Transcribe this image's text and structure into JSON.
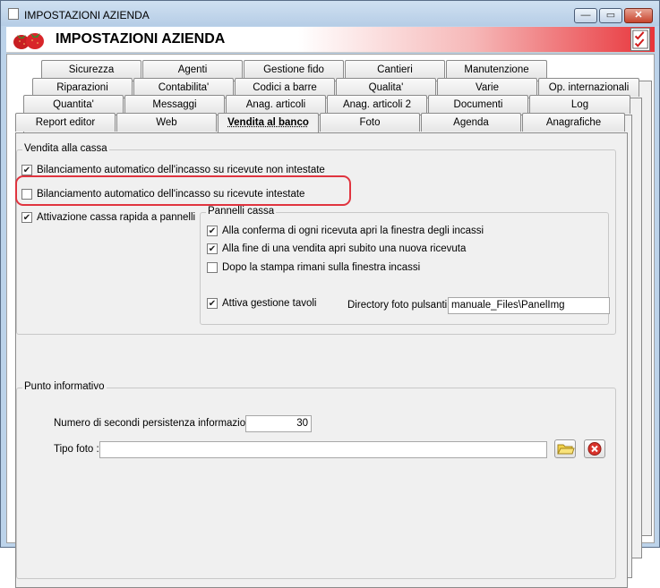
{
  "window": {
    "title": "IMPOSTAZIONI AZIENDA",
    "header_title": "IMPOSTAZIONI AZIENDA",
    "buttons": {
      "minimize": "—",
      "maximize": "▭",
      "close": "✕"
    }
  },
  "tabs": {
    "row1": [
      "Sicurezza",
      "Agenti",
      "Gestione fido",
      "Cantieri",
      "Manutenzione"
    ],
    "row2": [
      "Riparazioni",
      "Contabilita'",
      "Codici a barre",
      "Qualita'",
      "Varie",
      "Op. internazionali"
    ],
    "row3": [
      "Quantita'",
      "Messaggi",
      "Anag. articoli",
      "Anag. articoli 2",
      "Documenti",
      "Log"
    ],
    "row4": [
      "Report editor",
      "Web",
      "Vendita al banco",
      "Foto",
      "Agenda",
      "Anagrafiche"
    ],
    "active": "Vendita al banco"
  },
  "vendita_cassa": {
    "legend": "Vendita alla cassa",
    "bilanciamento_non_intestate": {
      "label": "Bilanciamento automatico dell'incasso su ricevute non intestate",
      "checked": true
    },
    "bilanciamento_intestate": {
      "label": "Bilanciamento automatico dell'incasso su ricevute intestate",
      "checked": false
    },
    "cassa_rapida": {
      "label": "Attivazione cassa rapida a pannelli",
      "checked": true
    }
  },
  "pannelli_cassa": {
    "legend": "Pannelli cassa",
    "conferma_ricevuta": {
      "label": "Alla conferma di ogni ricevuta apri la finestra degli incassi",
      "checked": true
    },
    "fine_vendita": {
      "label": "Alla fine di una vendita apri subito una nuova ricevuta",
      "checked": true
    },
    "stampa_incassi": {
      "label": "Dopo la stampa rimani sulla finestra incassi",
      "checked": false
    },
    "gestione_tavoli": {
      "label": "Attiva gestione tavoli",
      "checked": true
    },
    "directory_label": "Directory foto pulsanti :",
    "directory_value": "manuale_Files\\PanelImg"
  },
  "punto_informativo": {
    "legend": "Punto informativo",
    "secondi_label": "Numero di secondi persistenza informazioni :",
    "secondi_value": "30",
    "tipo_foto_label": "Tipo foto :",
    "tipo_foto_value": ""
  },
  "check_glyph": "✔",
  "colors": {
    "highlight": "#e0343f",
    "header_gradient_end": "#e8343a",
    "title_bar": "#bcd3ea"
  }
}
